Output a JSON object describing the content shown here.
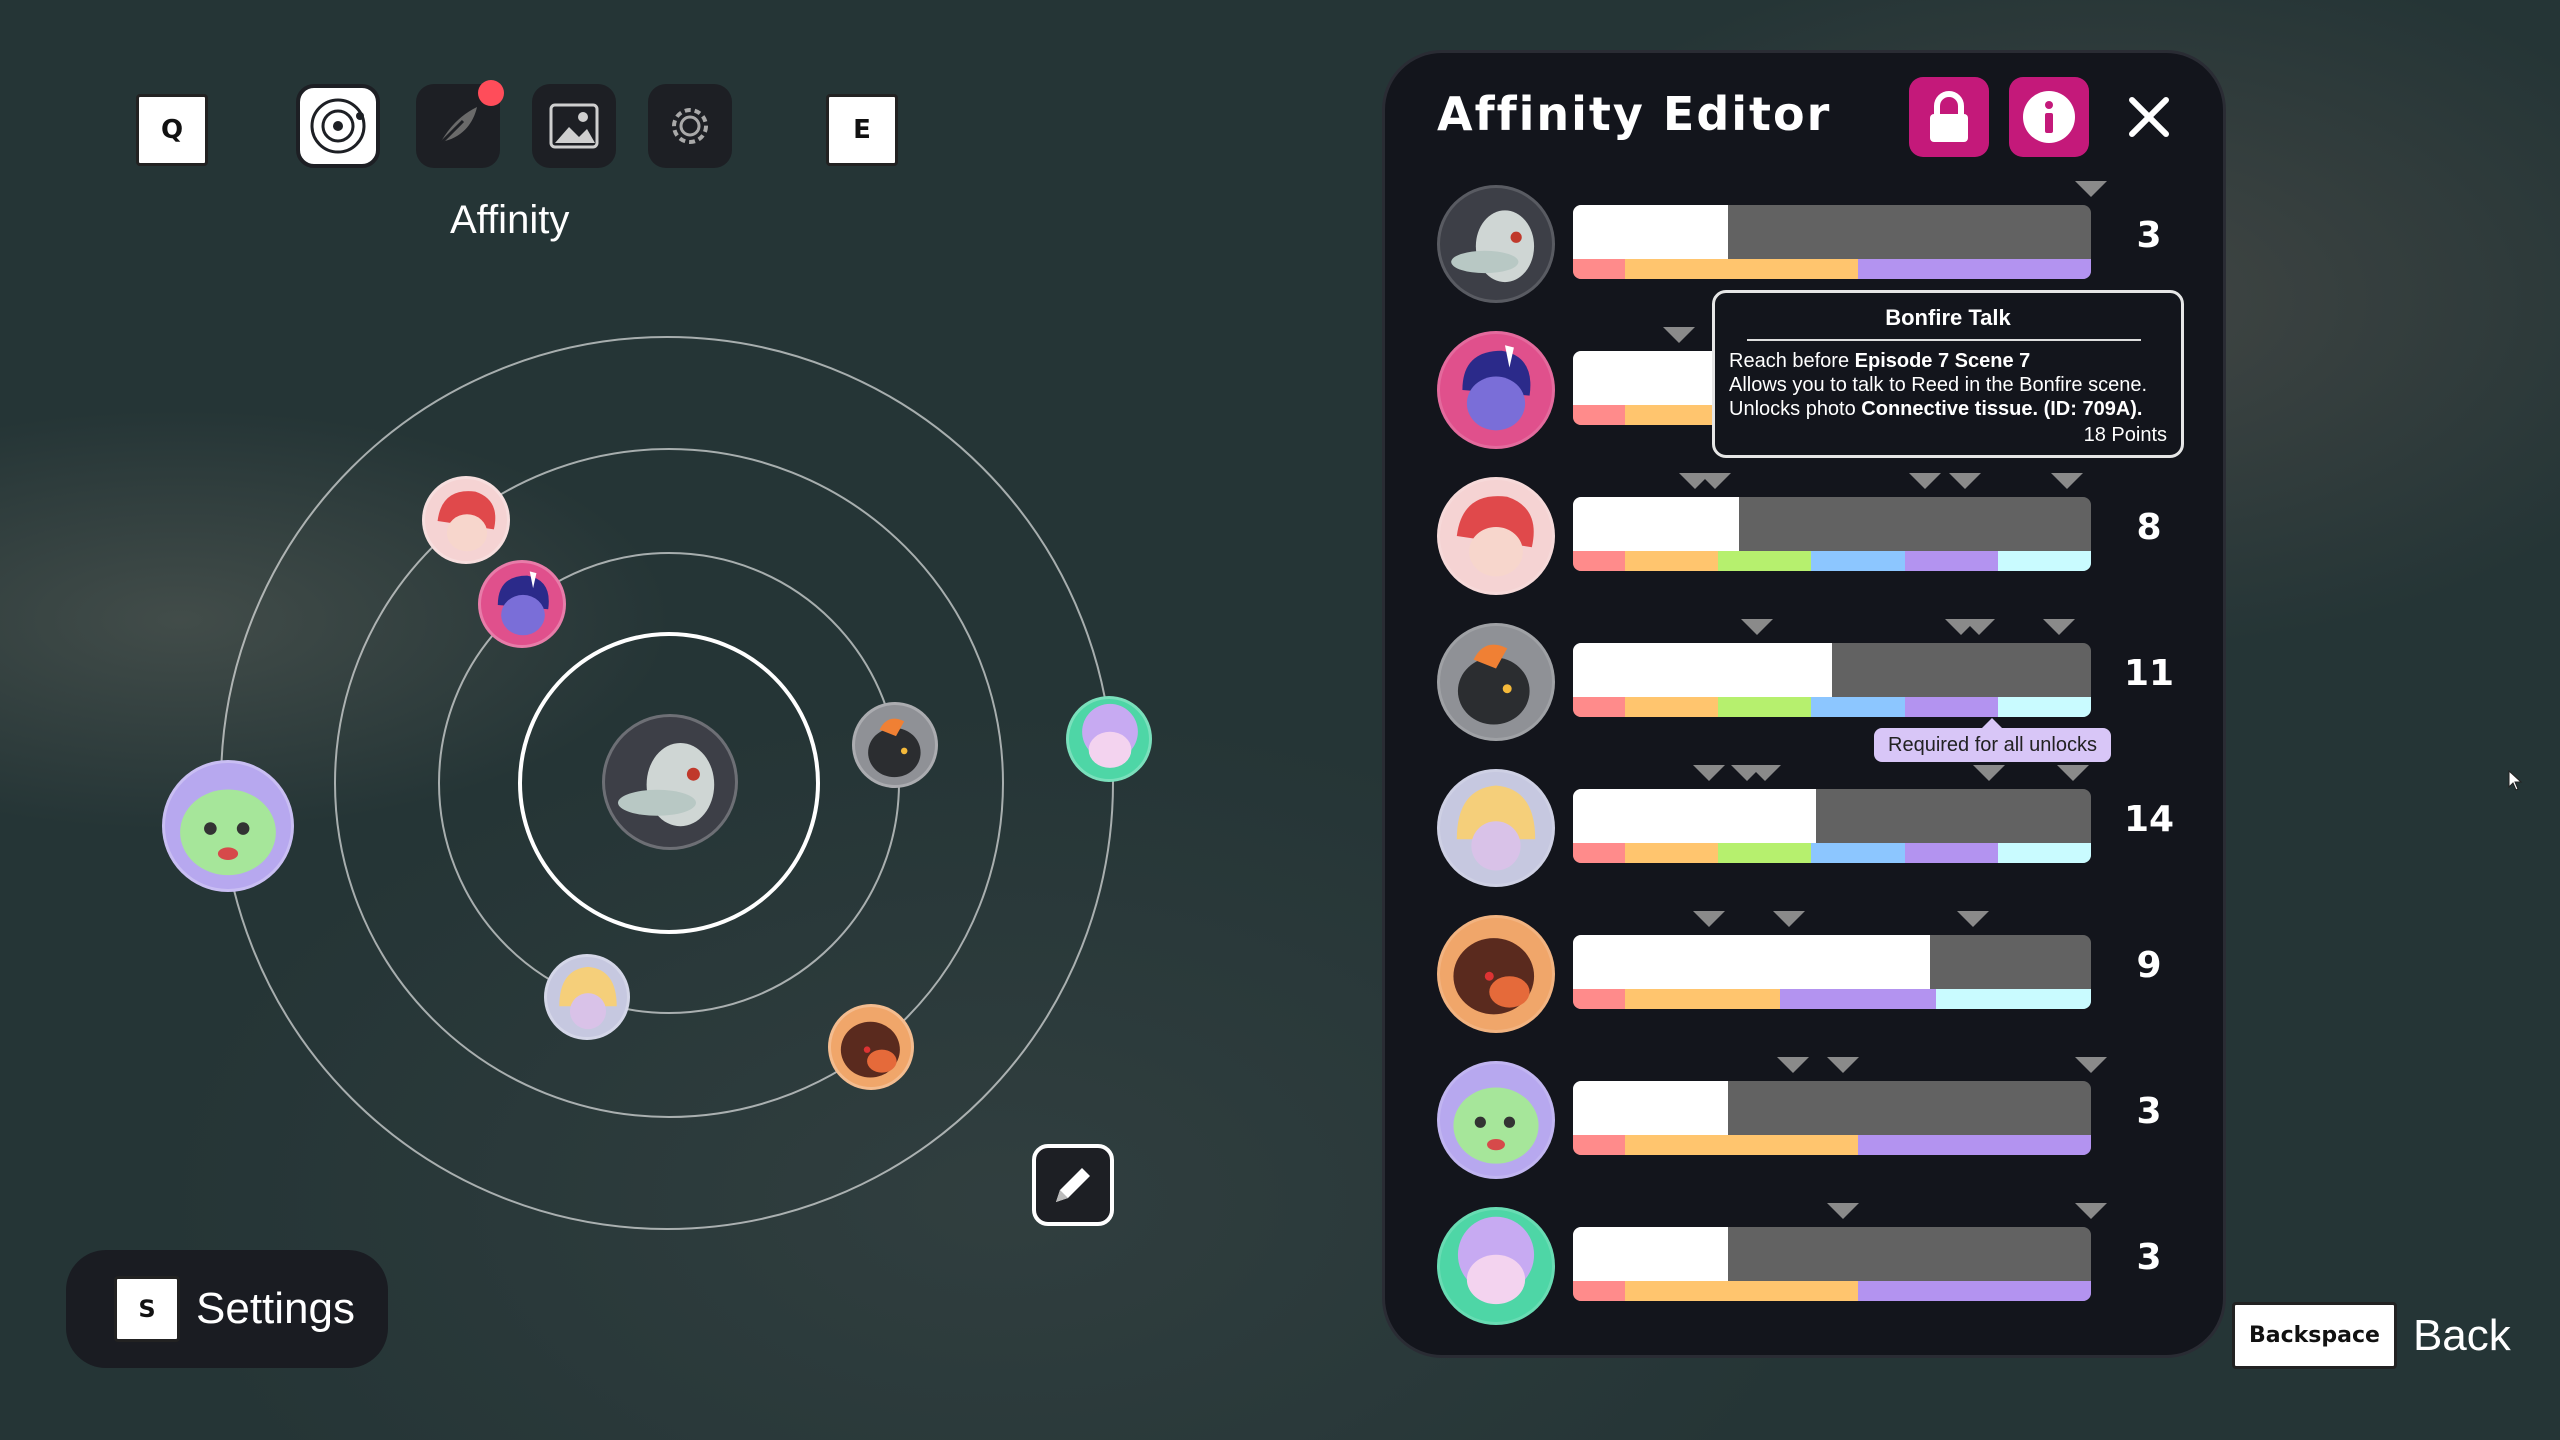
{
  "nav": {
    "left_key": "Q",
    "right_key": "E",
    "active_label": "Affinity",
    "tabs": [
      {
        "icon": "orbit-icon",
        "active": true
      },
      {
        "icon": "feather-icon",
        "notification": true
      },
      {
        "icon": "image-icon"
      },
      {
        "icon": "gear-icon"
      }
    ]
  },
  "settings": {
    "key": "S",
    "label": "Settings"
  },
  "back": {
    "key": "Backspace",
    "label": "Back"
  },
  "panel": {
    "title": "Affinity Editor",
    "accent": "#c4197a",
    "rows": [
      {
        "value": "3",
        "fill": 0.3,
        "colors": [
          "#ff8b8b",
          "#ffc56e",
          "#b393f0"
        ]
      },
      {
        "value": "",
        "fill": 0.3,
        "colors": [
          "#ff8b8b",
          "#ffc56e",
          "#b6f06e"
        ]
      },
      {
        "value": "8",
        "fill": 0.32,
        "colors": [
          "#ff8b8b",
          "#ffc56e",
          "#b6f06e",
          "#8cc6ff",
          "#b393f0",
          "#c9fbff"
        ]
      },
      {
        "value": "11",
        "fill": 0.5,
        "colors": [
          "#ff8b8b",
          "#ffc56e",
          "#b6f06e",
          "#8cc6ff",
          "#b393f0",
          "#c9fbff"
        ]
      },
      {
        "value": "14",
        "fill": 0.47,
        "colors": [
          "#ff8b8b",
          "#ffc56e",
          "#b6f06e",
          "#8cc6ff",
          "#b393f0",
          "#c9fbff"
        ]
      },
      {
        "value": "9",
        "fill": 0.69,
        "colors": [
          "#ff8b8b",
          "#ffc56e",
          "#b393f0",
          "#c9fbff"
        ]
      },
      {
        "value": "3",
        "fill": 0.3,
        "colors": [
          "#ff8b8b",
          "#ffc56e",
          "#b393f0"
        ]
      },
      {
        "value": "3",
        "fill": 0.3,
        "colors": [
          "#ff8b8b",
          "#ffc56e",
          "#b393f0"
        ]
      }
    ]
  },
  "tooltip": {
    "title": "Bonfire Talk",
    "line1_prefix": "Reach before ",
    "line1_bold": "Episode 7 Scene 7",
    "line2": "Allows you to talk to Reed in the Bonfire scene.",
    "line3_prefix": "Unlocks photo ",
    "line3_bold": "Connective tissue. (ID: 709A).",
    "points": "18 Points"
  },
  "required_tip": "Required for all unlocks"
}
